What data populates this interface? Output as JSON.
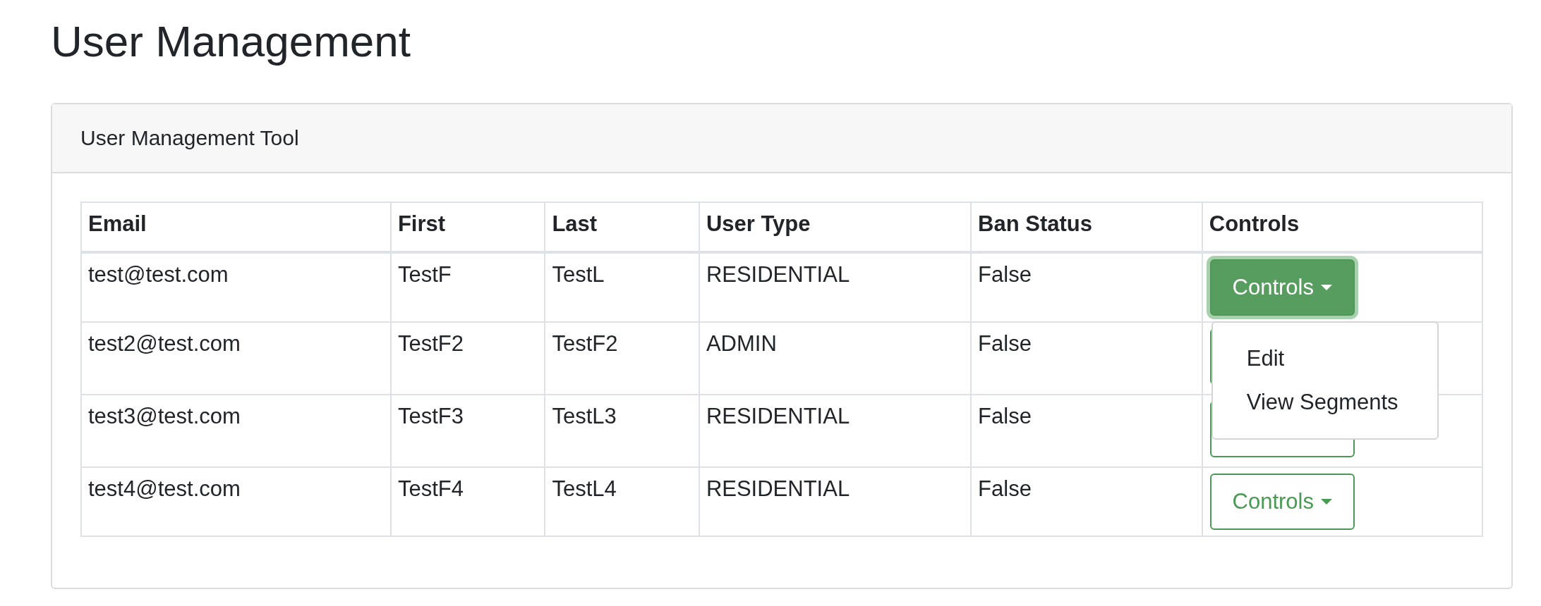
{
  "page": {
    "title": "User Management"
  },
  "card": {
    "header": "User Management Tool"
  },
  "table": {
    "columns": [
      "Email",
      "First",
      "Last",
      "User Type",
      "Ban Status",
      "Controls"
    ],
    "rows": [
      {
        "email": "test@test.com",
        "first": "TestF",
        "last": "TestL",
        "user_type": "RESIDENTIAL",
        "ban_status": "False",
        "controls": {
          "label": "Controls",
          "open": true
        }
      },
      {
        "email": "test2@test.com",
        "first": "TestF2",
        "last": "TestF2",
        "user_type": "ADMIN",
        "ban_status": "False",
        "controls": {
          "open": false
        }
      },
      {
        "email": "test3@test.com",
        "first": "TestF3",
        "last": "TestL3",
        "user_type": "RESIDENTIAL",
        "ban_status": "False",
        "controls": {
          "open": false
        }
      },
      {
        "email": "test4@test.com",
        "first": "TestF4",
        "last": "TestL4",
        "user_type": "RESIDENTIAL",
        "ban_status": "False",
        "controls": {
          "label": "Controls",
          "open": false
        }
      }
    ]
  },
  "dropdown": {
    "items": [
      {
        "label": "Edit"
      },
      {
        "label": "View Segments"
      }
    ]
  }
}
